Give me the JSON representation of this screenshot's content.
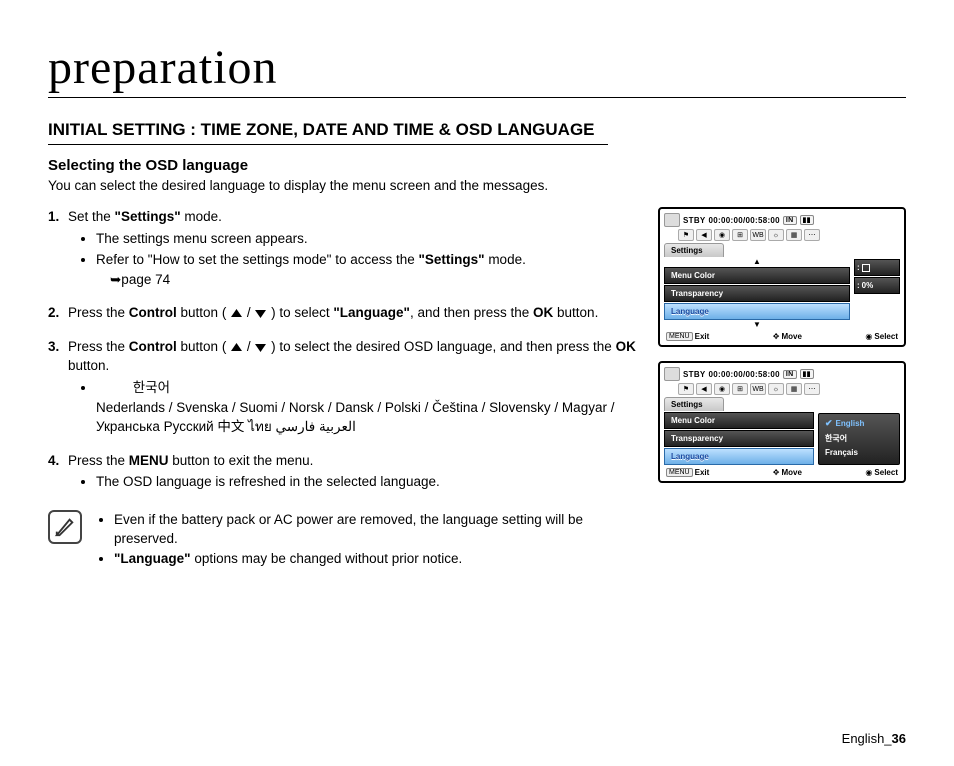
{
  "page_title": "preparation",
  "section_heading": "INITIAL SETTING : TIME ZONE, DATE AND TIME & OSD LANGUAGE",
  "sub_heading": "Selecting the OSD language",
  "intro": "You can select the desired language to display the menu screen and the messages.",
  "steps": {
    "s1": {
      "text_a": "Set the ",
      "bold_a": "\"Settings\"",
      "text_b": " mode.",
      "b1": "The settings menu screen appears.",
      "b2_a": "Refer to \"How to set the settings mode\" to access the ",
      "b2_bold": "\"Settings\"",
      "b2_b": " mode.",
      "ref": "➥page 74"
    },
    "s2": {
      "a": "Press the ",
      "b": "Control",
      "c": " button ( ",
      "d": " / ",
      "e": " ) to select ",
      "f": "\"Language\"",
      "g": ", and then press the ",
      "h": "OK",
      "i": " button."
    },
    "s3": {
      "a": "Press the ",
      "b": "Control",
      "c": " button ( ",
      "d": " / ",
      "e": " ) to select the desired OSD language, and then press the ",
      "f": "OK",
      "g": " button.",
      "lang_b1_ko": "한국어",
      "lang_line": "Nederlands / Svenska / Suomi / Norsk / Dansk / Polski / Čeština / Slovensky / Magyar / Укранська   Русский   中文   ไทย              العربية  فارسي"
    },
    "s4": {
      "a": "Press the ",
      "b": "MENU",
      "c": " button to exit the menu.",
      "b1": "The OSD language is refreshed in the selected language."
    }
  },
  "note": {
    "n1": "Even if the battery pack or AC power are removed, the language setting will be preserved.",
    "n2_a": "\"Language\"",
    "n2_b": " options may be changed without prior notice."
  },
  "footer": {
    "label": "English_",
    "num": "36"
  },
  "osd1": {
    "stby": "STBY",
    "timecode": "00:00:00/00:58:00",
    "in": "IN",
    "tab": "Settings",
    "items": [
      "Menu Color",
      "Transparency",
      "Language"
    ],
    "val_pct": "0%",
    "bottom": {
      "menu": "MENU",
      "exit": "Exit",
      "move": "Move",
      "select": "Select"
    }
  },
  "osd2": {
    "stby": "STBY",
    "timecode": "00:00:00/00:58:00",
    "in": "IN",
    "tab": "Settings",
    "items": [
      "Menu Color",
      "Transparency",
      "Language"
    ],
    "sub": [
      "English",
      "한국어",
      "Français"
    ],
    "bottom": {
      "menu": "MENU",
      "exit": "Exit",
      "move": "Move",
      "select": "Select"
    }
  }
}
